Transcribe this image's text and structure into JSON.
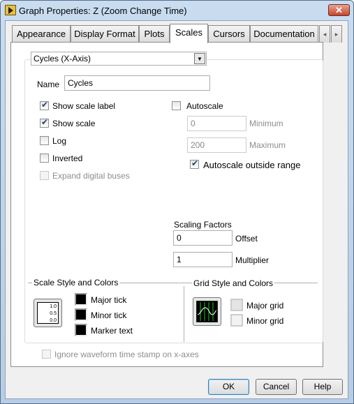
{
  "window": {
    "title": "Graph Properties: Z (Zoom Change Time)",
    "close": "✕"
  },
  "tabs": [
    {
      "label": "Appearance"
    },
    {
      "label": "Display Format"
    },
    {
      "label": "Plots"
    },
    {
      "label": "Scales",
      "active": true
    },
    {
      "label": "Cursors"
    },
    {
      "label": "Documentation"
    }
  ],
  "tab_scroll": {
    "left": "◂",
    "right": "▸"
  },
  "axis_select": {
    "value": "Cycles (X-Axis)"
  },
  "name": {
    "label": "Name",
    "value": "Cycles"
  },
  "options": [
    {
      "label": "Show scale label",
      "checked": true
    },
    {
      "label": "Show scale",
      "checked": true
    },
    {
      "label": "Log",
      "checked": false
    },
    {
      "label": "Inverted",
      "checked": false
    },
    {
      "label": "Expand digital buses",
      "checked": false,
      "disabled": true
    }
  ],
  "autoscale": {
    "label": "Autoscale",
    "checked": false,
    "minimum": {
      "label": "Minimum",
      "value": "0"
    },
    "maximum": {
      "label": "Maximum",
      "value": "200"
    },
    "outside": {
      "label": "Autoscale outside range",
      "checked": true
    }
  },
  "scaling": {
    "title": "Scaling Factors",
    "offset": {
      "label": "Offset",
      "value": "0"
    },
    "multiplier": {
      "label": "Multiplier",
      "value": "1"
    }
  },
  "scale_style": {
    "title": "Scale Style and Colors",
    "icon_ticks": [
      "1.0",
      "0.5",
      "0.0"
    ],
    "colors": [
      {
        "label": "Major tick",
        "color": "#000000"
      },
      {
        "label": "Minor tick",
        "color": "#000000"
      },
      {
        "label": "Marker text",
        "color": "#000000"
      }
    ]
  },
  "grid_style": {
    "title": "Grid Style and Colors",
    "colors": [
      {
        "label": "Major grid",
        "color": "#e4e4e4"
      },
      {
        "label": "Minor grid",
        "color": "#f2f2f2"
      }
    ]
  },
  "ignore_timestamp": {
    "label": "Ignore waveform time stamp on x-axes",
    "checked": false,
    "disabled": true
  },
  "buttons": {
    "ok": "OK",
    "cancel": "Cancel",
    "help": "Help"
  }
}
